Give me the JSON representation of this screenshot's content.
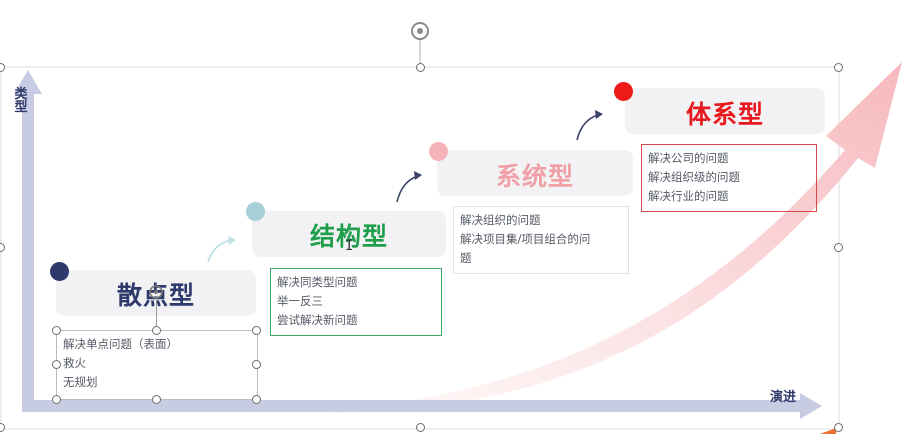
{
  "axes": {
    "y_label": "类型",
    "x_label": "演进"
  },
  "stages": [
    {
      "title": "散点型",
      "color": "#2e3a6b",
      "dot_color": "#2e3a6b",
      "lines": [
        "解决单点问题（表面）",
        "救火",
        "无规划"
      ]
    },
    {
      "title": "结构型",
      "color": "#1f9e4c",
      "dot_color": "#a9cfd8",
      "lines": [
        "解决同类型问题",
        "举一反三",
        "尝试解决新问题"
      ]
    },
    {
      "title": "系统型",
      "color": "#f0a0a6",
      "dot_color": "#f4b3b8",
      "lines": [
        "解决组织的问题",
        "解决项目集/项目组合的问",
        "题"
      ]
    },
    {
      "title": "体系型",
      "color": "#e8191e",
      "dot_color": "#ee1b1b",
      "lines": [
        "解决公司的问题",
        "解决组织级的问题",
        "解决行业的问题"
      ]
    }
  ],
  "colors": {
    "axis": "#c7cce2",
    "big_arrow": "#f7c3c7",
    "box2_border": "#3aa86b",
    "box3_border": "#e2e2e2",
    "box4_border": "#d9494e",
    "step_arrow": "#3a4468"
  }
}
